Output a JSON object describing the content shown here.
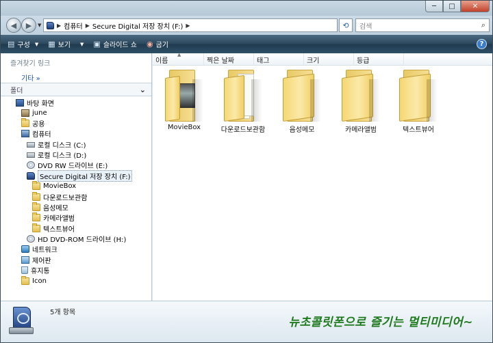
{
  "window": {
    "controls": {
      "minimize": "─",
      "maximize": "□",
      "close": "✕"
    }
  },
  "address": {
    "crumbs": [
      "컴퓨터",
      "Secure Digital 저장 장치 (F:)"
    ],
    "search_placeholder": "검색"
  },
  "toolbar": {
    "organize": "구성",
    "views": "보기",
    "slideshow": "슬라이드 쇼",
    "burn": "굽기",
    "help": "?"
  },
  "nav": {
    "favorites_header": "즐겨찾기 링크",
    "favorites_more": "기타 »",
    "folders_header": "폴더",
    "tree": [
      {
        "label": "바탕 화면",
        "icon": "desktop-icon"
      },
      {
        "label": "june",
        "icon": "user-folder-icon"
      },
      {
        "label": "공용",
        "icon": "folder-icon"
      },
      {
        "label": "컴퓨터",
        "icon": "computer-icon"
      },
      {
        "label": "로컬 디스크 (C:)",
        "icon": "drive-icon"
      },
      {
        "label": "로컬 디스크 (D:)",
        "icon": "drive-icon"
      },
      {
        "label": "DVD RW 드라이브 (E:)",
        "icon": "dvd-drive-icon"
      },
      {
        "label": "Secure Digital 저장 장치 (F:)",
        "icon": "sd-card-icon"
      },
      {
        "label": "MovieBox",
        "icon": "folder-icon"
      },
      {
        "label": "다운로드보관함",
        "icon": "folder-icon"
      },
      {
        "label": "음성메모",
        "icon": "folder-icon"
      },
      {
        "label": "카메라앨범",
        "icon": "folder-icon"
      },
      {
        "label": "텍스트뷰어",
        "icon": "folder-icon"
      },
      {
        "label": "HD DVD-ROM 드라이브 (H:)",
        "icon": "dvd-drive-icon"
      },
      {
        "label": "네트워크",
        "icon": "network-icon"
      },
      {
        "label": "제어판",
        "icon": "control-panel-icon"
      },
      {
        "label": "휴지통",
        "icon": "recycle-bin-icon"
      },
      {
        "label": "Icon",
        "icon": "folder-icon"
      }
    ]
  },
  "columns": [
    "이름",
    "찍은 날짜",
    "태그",
    "크기",
    "등급"
  ],
  "files": [
    {
      "name": "MovieBox",
      "icon": "folder-with-video-icon"
    },
    {
      "name": "다운로드보관함",
      "icon": "folder-with-files-icon"
    },
    {
      "name": "음성메모",
      "icon": "folder-icon"
    },
    {
      "name": "카메라앨범",
      "icon": "folder-icon"
    },
    {
      "name": "텍스트뷰어",
      "icon": "folder-icon"
    }
  ],
  "details": {
    "count": "5개 항목",
    "slogan": "뉴초콜릿폰으로 즐기는 멀티미디어~"
  }
}
